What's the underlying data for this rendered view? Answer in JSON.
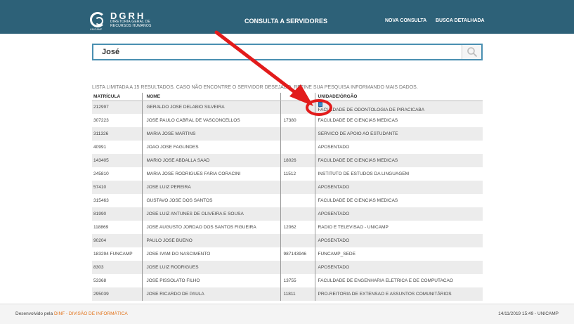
{
  "header": {
    "logo_name": "DGRH",
    "logo_desc": "DIRETORIA GERAL DE RECURSOS HUMANOS",
    "logo_sub": "UNICAMP",
    "title": "CONSULTA A SERVIDORES",
    "nav": [
      {
        "label": "NOVA CONSULTA"
      },
      {
        "label": "BUSCA DETALHADA"
      }
    ],
    "bg_color": "#2d6178"
  },
  "search": {
    "value": "José",
    "icon": "search-icon"
  },
  "notice": "LISTA LIMITADA A 15 RESULTADOS. CASO NÃO ENCONTRE O SERVIDOR DESEJADO, REFINE SUA PESQUISA INFORMANDO MAIS DADOS.",
  "table": {
    "headers": [
      "MATRÍCULA",
      "NOME",
      "",
      "UNIDADE/ÓRGÃO"
    ],
    "rows": [
      {
        "matricula": "212997",
        "nome": "GERALDO JOSE DELABIO SILVEIRA",
        "ramal": "",
        "unidade": "FACULDADE DE ODONTOLOGIA DE PIRACICABA",
        "icon": true
      },
      {
        "matricula": "307223",
        "nome": "JOSE PAULO CABRAL DE VASCONCELLOS",
        "ramal": "17380",
        "unidade": "FACULDADE DE CIENCIAS MEDICAS"
      },
      {
        "matricula": "311326",
        "nome": "MARIA JOSE MARTINS",
        "ramal": "",
        "unidade": "SERVICO DE APOIO AO ESTUDANTE"
      },
      {
        "matricula": "40991",
        "nome": "JOAO JOSE FAGUNDES",
        "ramal": "",
        "unidade": "APOSENTADO"
      },
      {
        "matricula": "143405",
        "nome": "MARIO JOSE ABDALLA SAAD",
        "ramal": "18026",
        "unidade": "FACULDADE DE CIENCIAS MEDICAS"
      },
      {
        "matricula": "245810",
        "nome": "MARIA JOSE RODRIGUES FARIA CORACINI",
        "ramal": "11512",
        "unidade": "INSTITUTO DE ESTUDOS DA LINGUAGEM"
      },
      {
        "matricula": "57410",
        "nome": "JOSE LUIZ PEREIRA",
        "ramal": "",
        "unidade": "APOSENTADO"
      },
      {
        "matricula": "315463",
        "nome": "GUSTAVO JOSE DOS SANTOS",
        "ramal": "",
        "unidade": "FACULDADE DE CIENCIAS MEDICAS"
      },
      {
        "matricula": "81990",
        "nome": "JOSE LUIZ ANTUNES DE OLIVEIRA E SOUSA",
        "ramal": "",
        "unidade": "APOSENTADO"
      },
      {
        "matricula": "118869",
        "nome": "JOSE AUGUSTO JORDAO DOS SANTOS FIGUEIRA",
        "ramal": "12062",
        "unidade": "RADIO E TELEVISAO - UNICAMP"
      },
      {
        "matricula": "90204",
        "nome": "PAULO JOSE BUENO",
        "ramal": "",
        "unidade": "APOSENTADO"
      },
      {
        "matricula": "183294 FUNCAMP",
        "nome": "JOSE IVAM DO NASCIMENTO",
        "ramal": "987143946",
        "unidade": "FUNCAMP_SEDE"
      },
      {
        "matricula": "8303",
        "nome": "JOSE LUIZ RODRIGUES",
        "ramal": "",
        "unidade": "APOSENTADO"
      },
      {
        "matricula": "53368",
        "nome": "JOSE PISSOLATO FILHO",
        "ramal": "13755",
        "unidade": "FACULDADE DE ENGENHARIA ELETRICA E DE COMPUTACAO"
      },
      {
        "matricula": "295039",
        "nome": "JOSE RICARDO DE PAULA",
        "ramal": "11811",
        "unidade": "PRO-REITORIA DE EXTENSAO E ASSUNTOS COMUNITÁRIOS"
      }
    ]
  },
  "annotation": {
    "color": "#e21b1b"
  },
  "footer": {
    "prefix": "Desenvolvido pela ",
    "link": "DINF - DIVISÃO DE INFORMÁTICA",
    "link_color": "#e2731a",
    "timestamp": "14/11/2019 15:49 - UNICAMP"
  }
}
